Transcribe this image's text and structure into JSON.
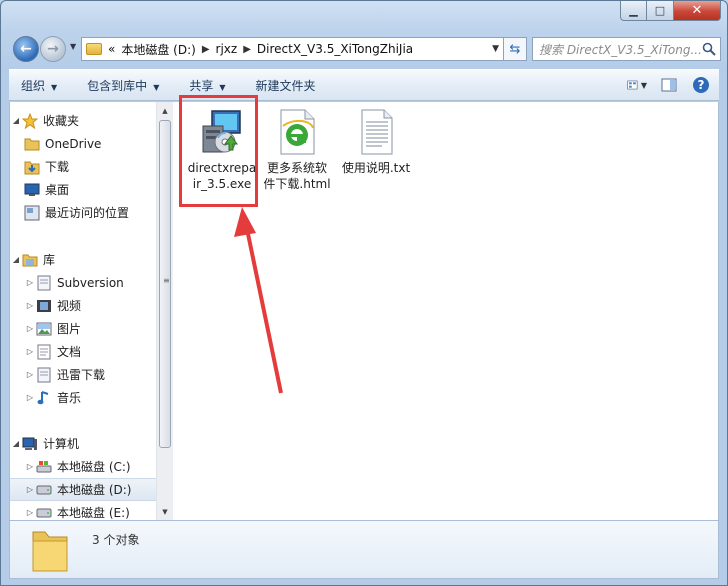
{
  "address": {
    "overflow": "«",
    "crumbs": [
      "本地磁盘 (D:)",
      "rjxz",
      "DirectX_V3.5_XiTongZhiJia"
    ]
  },
  "search": {
    "placeholder": "搜索 DirectX_V3.5_XiTong..."
  },
  "toolbar": {
    "organize": "组织",
    "include": "包含到库中",
    "share": "共享",
    "new_folder": "新建文件夹"
  },
  "sidebar": {
    "favorites": "收藏夹",
    "onedrive": "OneDrive",
    "downloads": "下载",
    "desktop": "桌面",
    "recent": "最近访问的位置",
    "libraries": "库",
    "subversion": "Subversion",
    "videos": "视频",
    "pictures": "图片",
    "documents": "文档",
    "thunder": "迅雷下载",
    "music": "音乐",
    "computer": "计算机",
    "drive_c": "本地磁盘 (C:)",
    "drive_d": "本地磁盘 (D:)",
    "drive_e": "本地磁盘 (E:)"
  },
  "files": [
    {
      "name": "directxrepair_3.5.exe",
      "icon": "installer-icon"
    },
    {
      "name": "更多系统软件下载.html",
      "icon": "ie-html-icon"
    },
    {
      "name": "使用说明.txt",
      "icon": "text-file-icon"
    }
  ],
  "status": {
    "count": "3 个对象"
  },
  "colors": {
    "highlight": "#e43c3c",
    "accent": "#2d6bb8"
  }
}
